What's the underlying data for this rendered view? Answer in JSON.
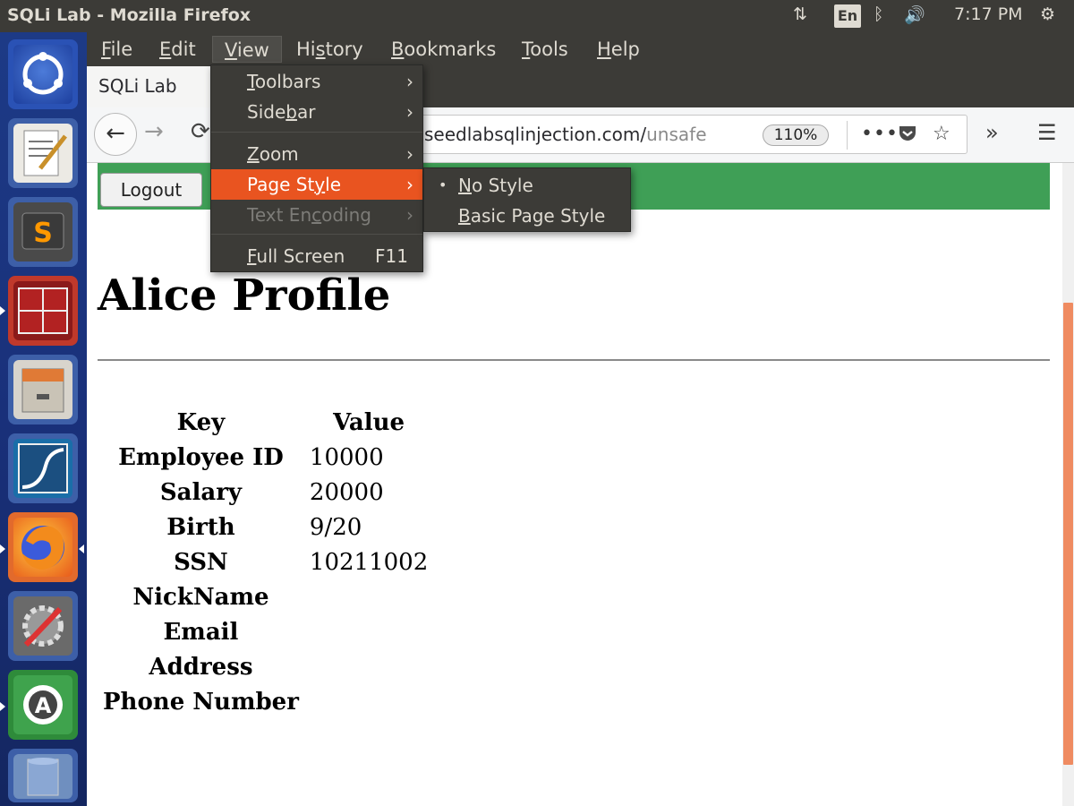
{
  "window": {
    "title": "SQLi Lab - Mozilla Firefox"
  },
  "top_panel": {
    "keyboard_layout": "En",
    "clock": "7:17 PM",
    "icons": [
      "network-icon",
      "bluetooth-icon",
      "volume-icon",
      "settings-gear-icon"
    ]
  },
  "launcher": {
    "items": [
      {
        "name": "ubuntu-dash-icon"
      },
      {
        "name": "text-editor-icon"
      },
      {
        "name": "sublime-text-icon"
      },
      {
        "name": "terminator-icon"
      },
      {
        "name": "file-manager-icon"
      },
      {
        "name": "wireshark-icon"
      },
      {
        "name": "firefox-icon"
      },
      {
        "name": "system-settings-icon"
      },
      {
        "name": "software-updater-icon"
      },
      {
        "name": "trash-icon"
      }
    ]
  },
  "menubar": {
    "items": [
      {
        "label": "File",
        "accel": "F"
      },
      {
        "label": "Edit",
        "accel": "E"
      },
      {
        "label": "View",
        "accel": "V"
      },
      {
        "label": "History",
        "accel": "s"
      },
      {
        "label": "Bookmarks",
        "accel": "B"
      },
      {
        "label": "Tools",
        "accel": "T"
      },
      {
        "label": "Help",
        "accel": "H"
      }
    ]
  },
  "tab": {
    "title": "SQLi Lab"
  },
  "navbar": {
    "url_visible": "seedlabsqlinjection.com/",
    "url_faded": "unsafe",
    "zoom": "110%",
    "more_label": "•••"
  },
  "view_menu": {
    "items": [
      {
        "label_pre": "",
        "accel": "T",
        "label_post": "oolbars",
        "arrow": "›"
      },
      {
        "label_pre": "Side",
        "accel": "b",
        "label_post": "ar",
        "arrow": "›"
      },
      {
        "label_pre": "",
        "accel": "Z",
        "label_post": "oom",
        "arrow": "›"
      },
      {
        "label_pre": "Page St",
        "accel": "y",
        "label_post": "le",
        "arrow": "›"
      },
      {
        "label_pre": "Text En",
        "accel": "c",
        "label_post": "oding",
        "arrow": "›"
      },
      {
        "label_pre": "",
        "accel": "F",
        "label_post": "ull Screen",
        "shortcut": "F11"
      }
    ]
  },
  "page_style_submenu": {
    "items": [
      {
        "accel": "N",
        "label_post": "o Style",
        "selected": true,
        "bullet": "•"
      },
      {
        "accel": "B",
        "label_post": "asic Page Style",
        "selected": false
      }
    ]
  },
  "page": {
    "logout_label": "Logout",
    "title": "Alice Profile",
    "table": {
      "headers": [
        "Key",
        "Value"
      ],
      "rows": [
        [
          "Employee ID",
          "10000"
        ],
        [
          "Salary",
          "20000"
        ],
        [
          "Birth",
          "9/20"
        ],
        [
          "SSN",
          "10211002"
        ],
        [
          "NickName",
          ""
        ],
        [
          "Email",
          ""
        ],
        [
          "Address",
          ""
        ],
        [
          "Phone Number",
          ""
        ]
      ]
    }
  },
  "colors": {
    "accent": "#e95420",
    "green_bar": "#3f9f56",
    "scroll_thumb": "#ef8b61"
  }
}
